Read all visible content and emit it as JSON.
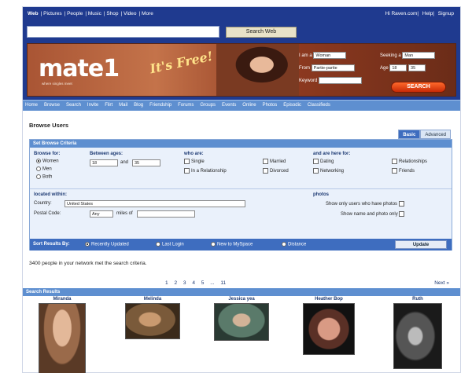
{
  "header": {
    "top_links": [
      "Web",
      "Pictures",
      "People",
      "Music",
      "Shop",
      "Video",
      "More"
    ],
    "right_links": [
      "Hi Raven.com",
      "Help",
      "Signup"
    ],
    "search_button": "Search Web"
  },
  "banner": {
    "logo": "mate1",
    "logo_sub": "where singles meet",
    "tagline": "It's Free!",
    "finder": {
      "i_am_label": "I am a",
      "i_am_value": "Woman",
      "seeking_label": "Seeking a",
      "seeking_value": "Man",
      "from_label": "From",
      "from_value": "Partie-partie",
      "age_label": "Age",
      "age_from": "18",
      "age_to": "35",
      "keyword_label": "Keyword",
      "search_button": "SEARCH"
    }
  },
  "nav": {
    "items": [
      "Home",
      "Browse",
      "Search",
      "Invite",
      "Flirt",
      "Mail",
      "Blog",
      "Friendship",
      "Forums",
      "Groups",
      "Events",
      "Online",
      "Photos",
      "Episodic",
      "Classifieds"
    ]
  },
  "browse": {
    "title": "Browse Users",
    "tabs": [
      "Basic",
      "Advanced"
    ],
    "panel_title": "Set Browse Criteria",
    "browse_for_label": "Browse for:",
    "browse_for_options": [
      "Women",
      "Men",
      "Both"
    ],
    "between_ages_label": "Between ages:",
    "age_from": "18",
    "and_label": "and",
    "age_to": "35",
    "who_are_label": "who are:",
    "who_are_options": [
      "Single",
      "In a Relationship",
      "Married",
      "Divorced"
    ],
    "and_are_here_for_label": "and are here for:",
    "here_for_options": [
      "Dating",
      "Networking",
      "Relationships",
      "Friends"
    ],
    "located_label": "located within:",
    "country_label": "Country:",
    "country_value": "United States",
    "postal_label": "Postal Code:",
    "postal_any": "Any",
    "miles_of_label": "miles of",
    "photos_label": "photos",
    "photo_option_1": "Show only users who have photos",
    "photo_option_2": "Show name and photo only",
    "sort_label": "Sort Results By:",
    "sort_options": [
      "Recently Updated",
      "Last Login",
      "New to MySpace",
      "Distance"
    ],
    "update_button": "Update"
  },
  "results": {
    "message": "3400 people in your network met the search criteria.",
    "pages": [
      "1",
      "2",
      "3",
      "4",
      "5",
      "...",
      "11"
    ],
    "next": "Next »",
    "header": "Search Results",
    "profiles": [
      {
        "name": "Miranda",
        "tone": "#c28a6a"
      },
      {
        "name": "Melinda",
        "tone": "#8a6a48"
      },
      {
        "name": "Jessica yea",
        "tone": "#5f7a6a"
      },
      {
        "name": "Heather Bop",
        "tone": "#a37060"
      },
      {
        "name": "Ruth",
        "tone": "#3a3a3a"
      }
    ]
  }
}
